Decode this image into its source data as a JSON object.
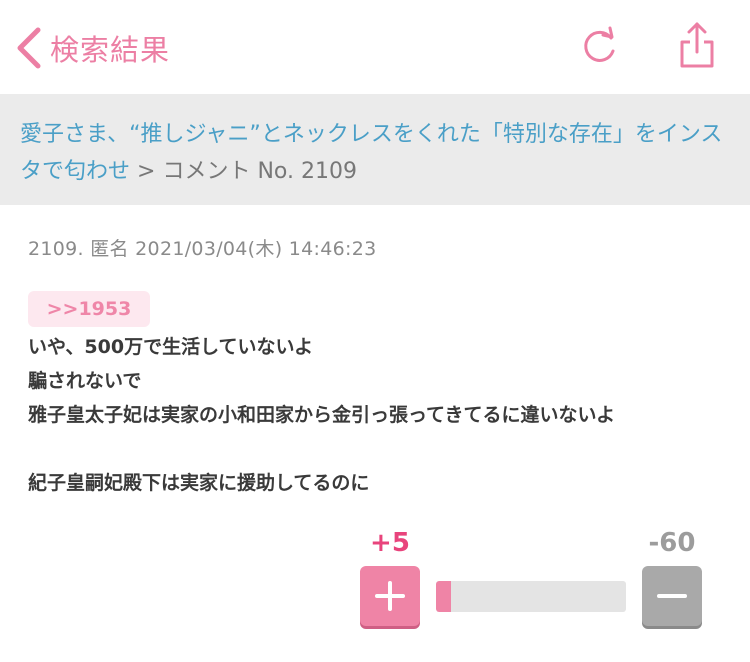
{
  "nav": {
    "back_label": "検索結果",
    "refresh_icon": "refresh-icon",
    "share_icon": "share-icon",
    "accent_color": "#ec7fa4"
  },
  "topic": {
    "title": "愛子さま、“推しジャニ”とネックレスをくれた「特別な存在」をインスタで匂わせ",
    "separator": ">",
    "breadcrumb_tail": "コメント No. 2109"
  },
  "comment": {
    "meta": "2109. 匿名 2021/03/04(木) 14:46:23",
    "anchor": ">>1953",
    "lines": [
      "いや、500万で生活していないよ",
      "騙されないで",
      "雅子皇太子妃は実家の小和田家から金引っ張ってきてるに違いないよ",
      "",
      "紀子皇嗣妃殿下は実家に援助してるのに"
    ]
  },
  "votes": {
    "plus_label": "+5",
    "minus_label": "-60",
    "plus_fraction": 0.077,
    "plus_color": "#ef84a6",
    "minus_color": "#a9a9a9"
  }
}
